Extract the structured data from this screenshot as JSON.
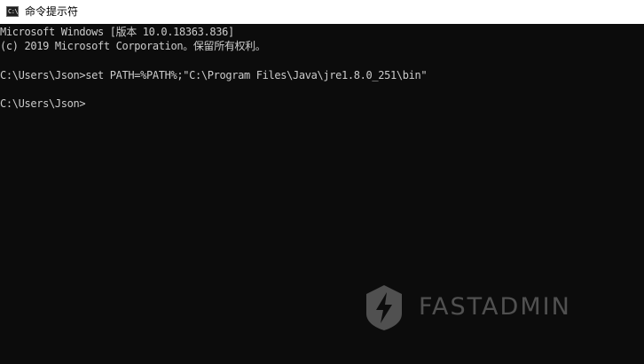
{
  "window": {
    "title": "命令提示符",
    "icon": "cmd-icon",
    "icon_glyph": "C:\\"
  },
  "console": {
    "lines": [
      "Microsoft Windows [版本 10.0.18363.836]",
      "(c) 2019 Microsoft Corporation。保留所有权利。",
      "C:\\Users\\Json>set PATH=%PATH%;\"C:\\Program Files\\Java\\jre1.8.0_251\\bin\"",
      "C:\\Users\\Json>"
    ],
    "background": "#0c0c0c",
    "foreground": "#cccccc"
  },
  "watermark": {
    "text": "FASTADMIN",
    "icon": "lightning-shield-icon"
  }
}
